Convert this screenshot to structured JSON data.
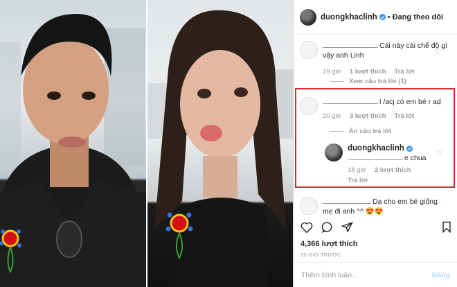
{
  "header": {
    "username": "duongkhaclinh",
    "separator": "•",
    "follow_status": "Đang theo dõi"
  },
  "comments": [
    {
      "text": "Cái này cài chế độ gì vậy anh Linh",
      "time": "19 giờ",
      "likes": "1 lượt thích",
      "reply": "Trả lời",
      "toggle": "Xem câu trả lời (1)"
    },
    {
      "text": "l /acj có em bé r ad",
      "time": "20 giờ",
      "likes": "3 lượt thích",
      "reply": "Trả lời",
      "toggle": "Ẩn câu trả lời"
    },
    {
      "author": "duongkhaclinh",
      "text": "e chua",
      "time": "18 giờ",
      "likes": "2 lượt thích",
      "reply": "Trả lời"
    },
    {
      "text": "Dạ cho em bé giống mẹ đi anh ^^ 😍😍"
    }
  ],
  "footer": {
    "likes": "4,366 lượt thích",
    "date": "20 GIỜ TRƯỚC",
    "add_comment_placeholder": "Thêm bình luận...",
    "post_label": "Đăng"
  },
  "icons": {
    "heart": "heart-icon",
    "comment": "comment-icon",
    "share": "share-icon",
    "bookmark": "bookmark-icon"
  },
  "colors": {
    "highlight_border": "#e0242b",
    "verified": "#3897f0",
    "post_button": "#b2dffc"
  }
}
